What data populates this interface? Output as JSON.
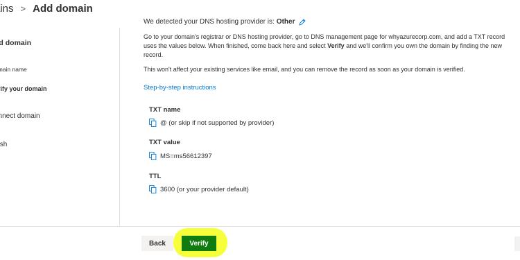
{
  "breadcrumb": {
    "parent": "Domains",
    "parent_visible": "ains",
    "separator": ">",
    "current": "Add domain"
  },
  "sidebar": {
    "title": "dd domain",
    "steps": [
      {
        "label": "omain name",
        "state": "done"
      },
      {
        "label": "erify your domain",
        "state": "active"
      },
      {
        "label": "onnect domain",
        "state": "pending"
      },
      {
        "label": "nish",
        "state": "pending"
      }
    ]
  },
  "main": {
    "provider_prefix": "We detected your DNS hosting provider is:",
    "provider_name": "Other",
    "instructions_line1": "Go to your domain's registrar or DNS hosting provider, go to DNS management page for whyazurecorp.com, and add a TXT record",
    "instructions_line2_pre": "uses the values below. When finished, come back here and select ",
    "instructions_verify_word": "Verify",
    "instructions_line2_post": " and we'll confirm you own the domain by finding the new",
    "instructions_line3": "record.",
    "note": "This won't affect your existing services like email, and you can remove the record as soon as your domain is verified.",
    "step_by_step_link": "Step-by-step instructions",
    "fields": [
      {
        "label": "TXT name",
        "value": "@ (or skip if not supported by provider)"
      },
      {
        "label": "TXT value",
        "value": "MS=ms56612397"
      },
      {
        "label": "TTL",
        "value": "3600 (or your provider default)"
      }
    ]
  },
  "footer": {
    "back_label": "Back",
    "verify_label": "Verify",
    "highlight_color": "#f5ff3b",
    "verify_color": "#107c10"
  },
  "icons": {
    "edit": "pencil-icon",
    "copy": "copy-icon"
  }
}
